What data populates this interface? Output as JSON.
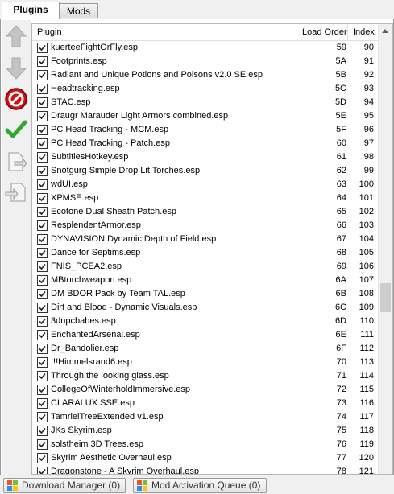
{
  "tabs": [
    {
      "label": "Plugins"
    },
    {
      "label": "Mods"
    }
  ],
  "columns": {
    "plugin": "Plugin",
    "load_order": "Load Order",
    "index": "Index"
  },
  "toolbar": {
    "icons": [
      "arrow-up-icon",
      "arrow-down-icon",
      "disable-icon",
      "check-icon",
      "export-icon",
      "import-icon"
    ]
  },
  "rows": [
    {
      "name": "kuerteeFightOrFly.esp",
      "lo": "59",
      "idx": "90"
    },
    {
      "name": "Footprints.esp",
      "lo": "5A",
      "idx": "91"
    },
    {
      "name": "Radiant and Unique Potions and Poisons v2.0 SE.esp",
      "lo": "5B",
      "idx": "92"
    },
    {
      "name": "Headtracking.esp",
      "lo": "5C",
      "idx": "93"
    },
    {
      "name": "STAC.esp",
      "lo": "5D",
      "idx": "94"
    },
    {
      "name": "Draugr Marauder Light Armors combined.esp",
      "lo": "5E",
      "idx": "95"
    },
    {
      "name": "PC Head Tracking - MCM.esp",
      "lo": "5F",
      "idx": "96"
    },
    {
      "name": "PC Head Tracking - Patch.esp",
      "lo": "60",
      "idx": "97"
    },
    {
      "name": "SubtitlesHotkey.esp",
      "lo": "61",
      "idx": "98"
    },
    {
      "name": "Snotgurg Simple Drop Lit Torches.esp",
      "lo": "62",
      "idx": "99"
    },
    {
      "name": "wdUI.esp",
      "lo": "63",
      "idx": "100"
    },
    {
      "name": "XPMSE.esp",
      "lo": "64",
      "idx": "101"
    },
    {
      "name": "Ecotone Dual Sheath Patch.esp",
      "lo": "65",
      "idx": "102"
    },
    {
      "name": "ResplendentArmor.esp",
      "lo": "66",
      "idx": "103"
    },
    {
      "name": "DYNAVISION Dynamic Depth of Field.esp",
      "lo": "67",
      "idx": "104"
    },
    {
      "name": "Dance for Septims.esp",
      "lo": "68",
      "idx": "105"
    },
    {
      "name": "FNIS_PCEA2.esp",
      "lo": "69",
      "idx": "106"
    },
    {
      "name": "MBtorchweapon.esp",
      "lo": "6A",
      "idx": "107"
    },
    {
      "name": "DM BDOR Pack by Team TAL.esp",
      "lo": "6B",
      "idx": "108"
    },
    {
      "name": "Dirt and Blood - Dynamic Visuals.esp",
      "lo": "6C",
      "idx": "109"
    },
    {
      "name": "3dnpcbabes.esp",
      "lo": "6D",
      "idx": "110"
    },
    {
      "name": "EnchantedArsenal.esp",
      "lo": "6E",
      "idx": "111"
    },
    {
      "name": "Dr_Bandolier.esp",
      "lo": "6F",
      "idx": "112"
    },
    {
      "name": "!!!Himmelsrand6.esp",
      "lo": "70",
      "idx": "113"
    },
    {
      "name": "Through the looking glass.esp",
      "lo": "71",
      "idx": "114"
    },
    {
      "name": "CollegeOfWinterholdImmersive.esp",
      "lo": "72",
      "idx": "115"
    },
    {
      "name": "CLARALUX SSE.esp",
      "lo": "73",
      "idx": "116"
    },
    {
      "name": "TamrielTreeExtended v1.esp",
      "lo": "74",
      "idx": "117"
    },
    {
      "name": "JKs Skyrim.esp",
      "lo": "75",
      "idx": "118"
    },
    {
      "name": "solstheim 3D Trees.esp",
      "lo": "76",
      "idx": "119"
    },
    {
      "name": "Skyrim Aesthetic Overhaul.esp",
      "lo": "77",
      "idx": "120"
    },
    {
      "name": "Dragonstone - A Skyrim Overhaul.esp",
      "lo": "78",
      "idx": "121"
    }
  ],
  "status": {
    "download_manager": "Download Manager (0)",
    "mod_activation_queue": "Mod Activation Queue (0)"
  }
}
